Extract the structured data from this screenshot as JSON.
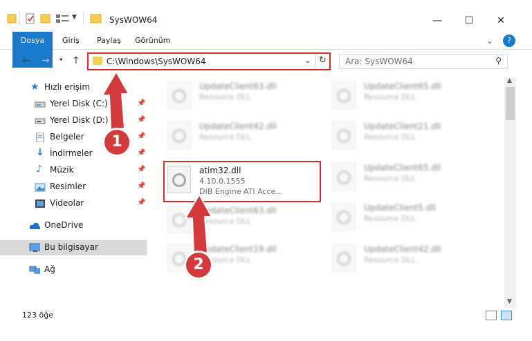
{
  "window": {
    "title": "SysWOW64"
  },
  "ribbon": {
    "tabs": [
      {
        "label": "Dosya"
      },
      {
        "label": "Giriş"
      },
      {
        "label": "Paylaş"
      },
      {
        "label": "Görünüm"
      }
    ],
    "help_label": "?"
  },
  "address": {
    "path": "C:\\Windows\\SysWOW64",
    "search_placeholder": "Ara: SysWOW64"
  },
  "nav": {
    "items": [
      {
        "label": "Hızlı erişim",
        "icon": "star-icon"
      },
      {
        "label": "Yerel Disk (C:)",
        "icon": "drive-icon"
      },
      {
        "label": "Yerel Disk (D:)",
        "icon": "drive-icon"
      },
      {
        "label": "Belgeler",
        "icon": "documents-icon"
      },
      {
        "label": "İndirmeler",
        "icon": "download-icon"
      },
      {
        "label": "Müzik",
        "icon": "music-icon"
      },
      {
        "label": "Resimler",
        "icon": "pictures-icon"
      },
      {
        "label": "Videolar",
        "icon": "videos-icon"
      },
      {
        "label": "OneDrive",
        "icon": "cloud-icon"
      },
      {
        "label": "Bu bilgisayar",
        "icon": "computer-icon"
      },
      {
        "label": "Ağ",
        "icon": "network-icon"
      }
    ]
  },
  "files": {
    "highlighted": {
      "name": "atim32.dll",
      "version": "4.10.0.1555",
      "description": "DIB Engine ATI Acce..."
    },
    "left": [
      {
        "name": "UpdateClient63.dll",
        "sub": "Resource DLL"
      },
      {
        "name": "UpdateClient42.dll",
        "sub": "Resource DLL"
      },
      {
        "name": "UpdateClient63.dll",
        "sub": "Resource DLL"
      },
      {
        "name": "UpdateClient19.dll",
        "sub": "Resource DLL"
      }
    ],
    "right": [
      {
        "name": "UpdateClient65.dll",
        "sub": "Resource DLL"
      },
      {
        "name": "UpdateClient21.dll",
        "sub": "Resource DLL"
      },
      {
        "name": "UpdateClient65.dll",
        "sub": "Resource DLL"
      },
      {
        "name": "UpdateClient5.dll",
        "sub": "Resource DLL"
      },
      {
        "name": "UpdateClient42.dll",
        "sub": "Resource DLL"
      }
    ]
  },
  "status": {
    "count": "123 öğe"
  },
  "callouts": [
    "1",
    "2"
  ],
  "colors": {
    "accent": "#1979ca",
    "highlight": "#d62a2e",
    "callout": "#d23a3b"
  }
}
